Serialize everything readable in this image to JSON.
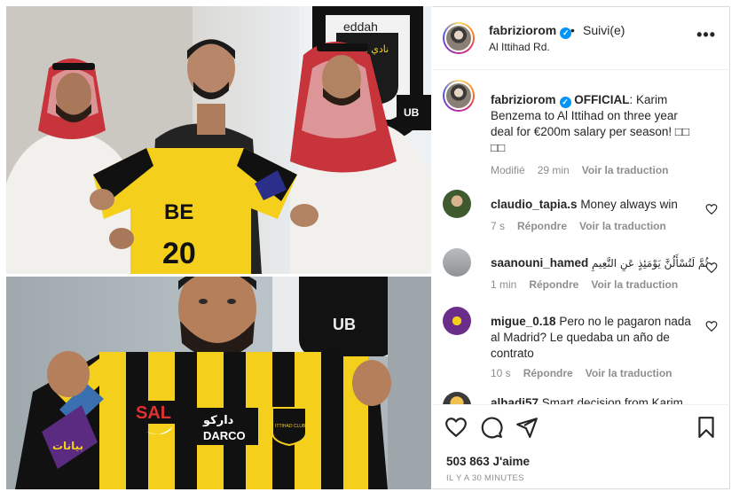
{
  "post": {
    "username": "fabriziorom",
    "follow_status": "Suivi(e)",
    "separator": "•",
    "location": "Al Ittihad Rd.",
    "more_glyph": "•••",
    "verified_glyph": "✓"
  },
  "photo": {
    "banner_text": "eddah",
    "banner_arabic": "نادي الاتحاد",
    "banner_suffix": "UB",
    "shirt_name": "BE",
    "shirt_number": "20",
    "shirt_sponsor_ar": "دارکو",
    "shirt_sponsor_en": "DARCO",
    "shirt_brand": "SAL",
    "shirt_crest_label": "ITTIHAD CLUB",
    "shirt_sleeve_sponsor": "بيانات"
  },
  "caption": {
    "username": "fabriziorom",
    "bold_text": "OFFICIAL",
    "text": ": Karim Benzema to Al Ittihad on three year deal for €200m salary per season! □□ □□",
    "edited": "Modifié",
    "time": "29 min",
    "translate": "Voir la traduction"
  },
  "comments": [
    {
      "username": "claudio_tapia.s",
      "text": "Money always win",
      "time": "7 s",
      "reply": "Répondre",
      "translate": "Voir la traduction"
    },
    {
      "username": "saanouni_hamed",
      "text": "ثُمَّ لَتُسْأَلُنَّ يَوْمَئِذٍ عَنِ النَّعِيمِ",
      "time": "1 min",
      "reply": "Répondre",
      "translate": "Voir la traduction"
    },
    {
      "username": "migue_0.18",
      "text": "Pero no le pagaron nada al Madrid? Le quedaba un año de contrato",
      "time": "10 s",
      "reply": "Répondre",
      "translate": "Voir la traduction"
    },
    {
      "username": "alhadi57",
      "text": "Smart decision from Karim"
    }
  ],
  "actions": {
    "likes": "503 863 J'aime",
    "time_ago": "IL Y A 30 MINUTES"
  },
  "icons": {
    "like": "heart-icon",
    "comment": "comment-icon",
    "share": "share-icon",
    "save": "bookmark-icon"
  },
  "colors": {
    "verified": "#0095f6",
    "muted": "#8e8e8e",
    "text": "#262626",
    "jersey_yellow": "#f4cf1c",
    "jersey_black": "#111111"
  }
}
